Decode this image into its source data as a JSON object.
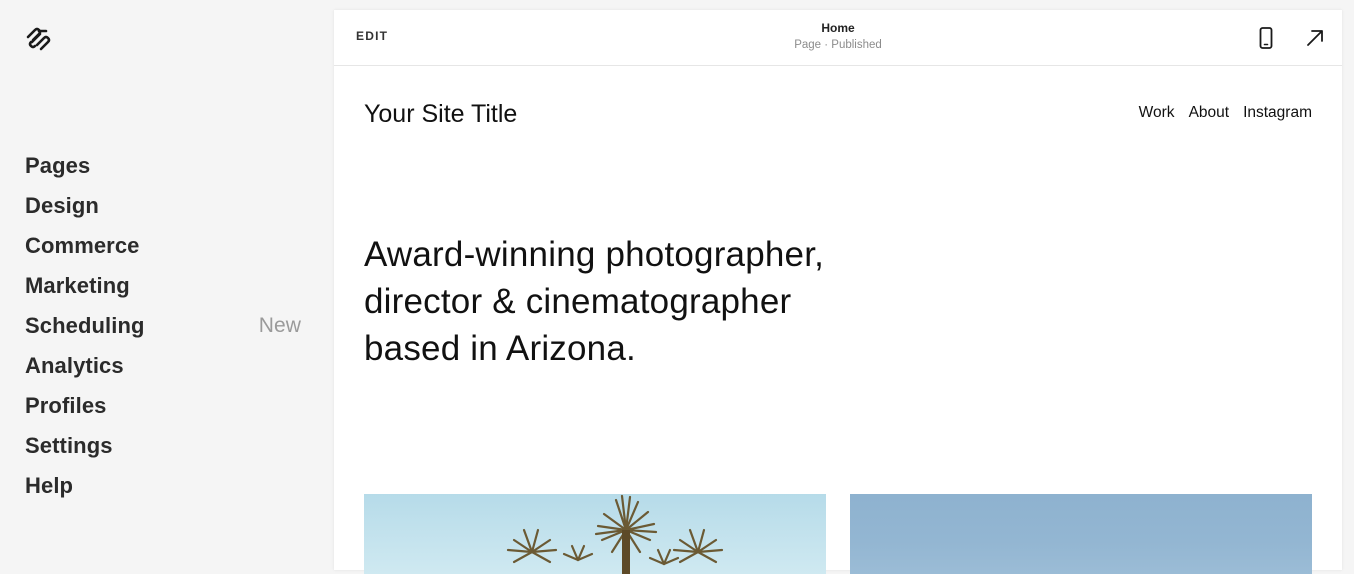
{
  "sidebar": {
    "logo_icon": "squarespace-logo-icon",
    "items": [
      {
        "label": "Pages"
      },
      {
        "label": "Design"
      },
      {
        "label": "Commerce"
      },
      {
        "label": "Marketing"
      },
      {
        "label": "Scheduling",
        "badge": "New"
      },
      {
        "label": "Analytics"
      },
      {
        "label": "Profiles"
      },
      {
        "label": "Settings"
      },
      {
        "label": "Help"
      }
    ]
  },
  "toolbar": {
    "edit_label": "EDIT",
    "page_name": "Home",
    "page_status": "Page · Published",
    "mobile_icon": "mobile-preview-icon",
    "open_icon": "open-external-icon"
  },
  "site": {
    "title": "Your Site Title",
    "nav": [
      "Work",
      "About",
      "Instagram"
    ],
    "headline": "Award-winning photographer, director & cinematographer based in Arizona."
  },
  "colors": {
    "sidebar_bg": "#f5f5f5",
    "panel_bg": "#ffffff",
    "badge_text": "#9a9a9a",
    "sky_light": "#bfe0ec",
    "sky_blue": "#8eb2cf"
  }
}
